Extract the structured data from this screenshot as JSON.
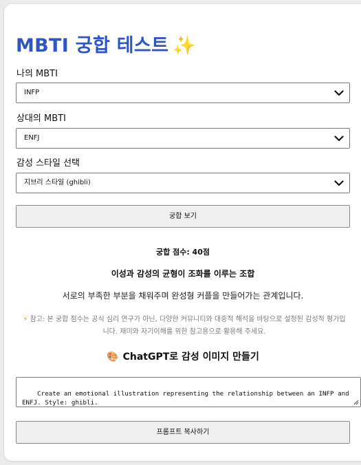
{
  "header": {
    "title": "MBTI 궁합 테스트",
    "title_emoji": "✨",
    "accent_color": "#2d55c4"
  },
  "form": {
    "my_mbti_label": "나의 MBTI",
    "my_mbti_value": "INFP",
    "partner_mbti_label": "상대의 MBTI",
    "partner_mbti_value": "ENFJ",
    "style_label": "감성 스타일 선택",
    "style_value": "지브리 스타일 (ghibli)",
    "submit_label": "궁합 보기"
  },
  "result": {
    "score_text": "궁합 점수: 40점",
    "headline": "이성과 감성의 균형이 조화를 이루는 조합",
    "description": "서로의 부족한 부분을 채워주며 완성형 커플을 만들어가는 관계입니다.",
    "note_icon": "⚡",
    "note_text": "참고: 본 궁합 점수는 공식 심리 연구가 아닌, 다양한 커뮤니티와 대중적 해석을 바탕으로 설정된 감성적 평가입니다. 재미와 자기이해를 위한 참고용으로 활용해 주세요."
  },
  "prompt_section": {
    "icon": "🎨",
    "title": "ChatGPT로 감성 이미지 만들기",
    "prompt_text": "Create an emotional illustration representing the relationship between an INFP and ENFJ. Style: ghibli.",
    "copy_label": "프롬프트 복사하기"
  }
}
